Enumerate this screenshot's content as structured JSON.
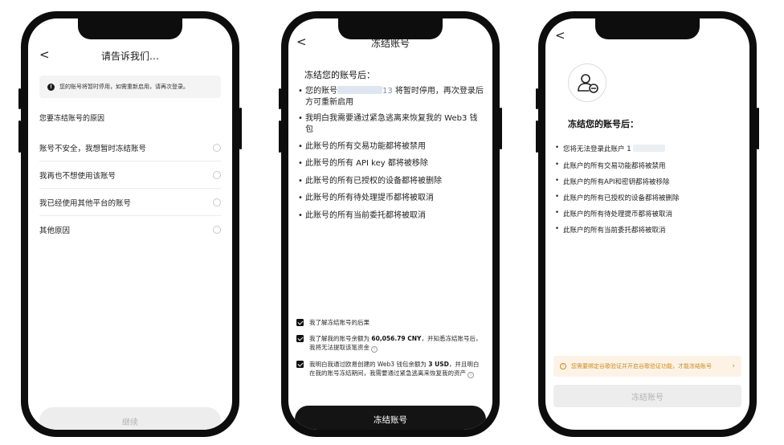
{
  "phone1": {
    "back": "<",
    "title": "请告诉我们…",
    "notice_icon": "!",
    "notice": "您的账号将暂时停用，如需重新启用，请再次登录。",
    "reasons_heading": "您要冻结账号的原因",
    "reasons": [
      "账号不安全，我想暂时冻结账号",
      "我再也不想使用该账号",
      "我已经使用其他平台的账号",
      "其他原因"
    ],
    "continue_label": "继续"
  },
  "phone2": {
    "back": "<",
    "title": "冻结账号",
    "heading": "冻结您的账号后：",
    "bullet": "•",
    "bullets": {
      "b1_prefix": "您的账号",
      "b1_masked_tail": "13",
      "b1_suffix": "将暂时停用，再次登录后方可重新启用",
      "b2": "我明白我需要通过紧急逃离来恢复我的 Web3 钱包",
      "b3": "此账号的所有交易功能都将被禁用",
      "b4": "此账号的所有 API key 都将被移除",
      "b5": "此账号的所有已授权的设备都将被删除",
      "b6": "此账号的所有待处理提币都将被取消",
      "b7": "此账号的所有当前委托都将被取消"
    },
    "checks": {
      "c1": "我了解冻结账号的后果",
      "c2_a": "我了解我的账号余额为 ",
      "c2_amount": "60,056.79 CNY",
      "c2_b": "，并知悉冻结账号后，我将无法提取该笔资金",
      "c3_a": "我明白我通过欧易创建的 Web3 钱包余额为 ",
      "c3_amount": "3 USD",
      "c3_b": "，并且明白在我的账号冻结期间，我需要通过紧急逃离来恢复我的资产"
    },
    "info_mark": "i",
    "freeze_label": "冻结账号"
  },
  "phone3": {
    "back": "<",
    "heading": "冻结您的账号后：",
    "bullet": "•",
    "b1_prefix": "您将无法登录此账户",
    "b1_visible": "1",
    "b2": "此账户的所有交易功能都将被禁用",
    "b3": "此账户的所有API和密钥都将被移除",
    "b4": "此账户的所有已授权的设备都将被删除",
    "b5": "此账户的所有待处理提币都将被取消",
    "b6": "此账户的所有当前委托都将被取消",
    "warning_icon": "!",
    "warning": "您需要绑定谷歌验证并开启谷歌验证功能，才能冻结账号",
    "warning_chevron": "›",
    "freeze_label": "冻结账号"
  },
  "colors": {
    "phone_frame": "#0d0d0d",
    "primary_button": "#141414",
    "disabled_button": "#ededed",
    "warning_bg": "#fcf3e6",
    "warning_text": "#cc8a22"
  }
}
